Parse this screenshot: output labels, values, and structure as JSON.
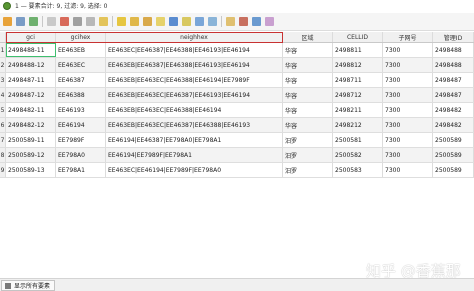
{
  "window": {
    "title": "1 — 要素合计: 9, 过滤: 9, 选择: 0"
  },
  "columns": [
    "gci",
    "gcihex",
    "neighhex",
    "区域",
    "CELLID",
    "子网号",
    "管理ID"
  ],
  "rows": [
    {
      "n": "1",
      "gci": "2498488-11",
      "gcihex": "EE463EB",
      "neighhex": "EE463EC|EE46387|EE46388|EE46193|EE46194",
      "region": "华容",
      "cellid": "2498811",
      "subnet": "7300",
      "mgmt": "2498488"
    },
    {
      "n": "2",
      "gci": "2498488-12",
      "gcihex": "EE463EC",
      "neighhex": "EE463EB|EE46387|EE46388|EE46193|EE46194",
      "region": "华容",
      "cellid": "2498812",
      "subnet": "7300",
      "mgmt": "2498488"
    },
    {
      "n": "3",
      "gci": "2498487-11",
      "gcihex": "EE46387",
      "neighhex": "EE463EB|EE463EC|EE46388|EE46194|EE7989F",
      "region": "华容",
      "cellid": "2498711",
      "subnet": "7300",
      "mgmt": "2498487"
    },
    {
      "n": "4",
      "gci": "2498487-12",
      "gcihex": "EE46388",
      "neighhex": "EE463EB|EE463EC|EE46387|EE46193|EE46194",
      "region": "华容",
      "cellid": "2498712",
      "subnet": "7300",
      "mgmt": "2498487"
    },
    {
      "n": "5",
      "gci": "2498482-11",
      "gcihex": "EE46193",
      "neighhex": "EE463EB|EE463EC|EE46388|EE46194",
      "region": "华容",
      "cellid": "2498211",
      "subnet": "7300",
      "mgmt": "2498482"
    },
    {
      "n": "6",
      "gci": "2498482-12",
      "gcihex": "EE46194",
      "neighhex": "EE463EB|EE463EC|EE46387|EE46388|EE46193",
      "region": "华容",
      "cellid": "2498212",
      "subnet": "7300",
      "mgmt": "2498482"
    },
    {
      "n": "7",
      "gci": "2500589-11",
      "gcihex": "EE7989F",
      "neighhex": "EE46194|EE46387|EE798A0|EE798A1",
      "region": "汨罗",
      "cellid": "2500581",
      "subnet": "7300",
      "mgmt": "2500589"
    },
    {
      "n": "8",
      "gci": "2500589-12",
      "gcihex": "EE798A0",
      "neighhex": "EE46194|EE7989F|EE798A1",
      "region": "汨罗",
      "cellid": "2500582",
      "subnet": "7300",
      "mgmt": "2500589"
    },
    {
      "n": "9",
      "gci": "2500589-13",
      "gcihex": "EE798A1",
      "neighhex": "EE463EC|EE46194|EE7989F|EE798A0",
      "region": "汨罗",
      "cellid": "2500583",
      "subnet": "7300",
      "mgmt": "2500589"
    }
  ],
  "bottombar": {
    "filter_label": "显示所有要素"
  },
  "watermark": "知乎 @香蕉那",
  "toolbar_icons": [
    "pencil-icon",
    "save-icon",
    "refresh-icon",
    "edit-toggle-icon",
    "delete-icon",
    "cut-icon",
    "copy-icon",
    "paste-icon",
    "select-expression-icon",
    "select-all-icon",
    "invert-selection-icon",
    "deselect-icon",
    "filter-icon",
    "move-top-icon",
    "pan-icon",
    "zoom-icon",
    "new-field-icon",
    "delete-field-icon",
    "field-calculator-icon",
    "conditional-format-icon"
  ],
  "colors": {
    "accent_red": "#c83232",
    "selection_green": "#3fbf6f",
    "qgis_green": "#589632"
  }
}
